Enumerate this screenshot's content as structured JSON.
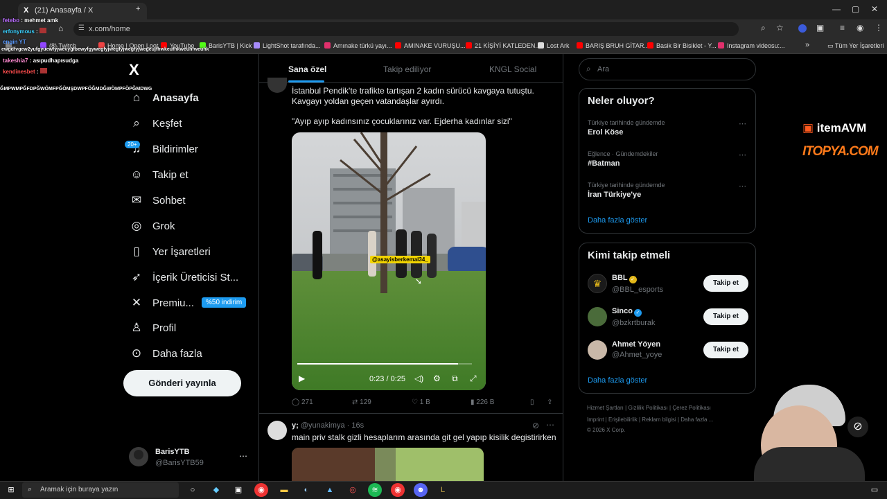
{
  "browser": {
    "tab_title": "(21) Anasayfa / X",
    "url": "x.com/home",
    "bookmarks": [
      {
        "label": "",
        "color": "#888"
      },
      {
        "label": "(8) Twitch",
        "color": "#9146ff"
      },
      {
        "label": "Home | Open Loot",
        "color": "#e44"
      },
      {
        "label": "YouTube",
        "color": "#f00"
      },
      {
        "label": "BarisYTB | Kick",
        "color": "#53fc18"
      },
      {
        "label": "LightShot tarafında...",
        "color": "#a78bfa"
      },
      {
        "label": "Amınake türkü yayı...",
        "color": "#e1306c"
      },
      {
        "label": "AMINAKE VURUŞU...",
        "color": "#f00"
      },
      {
        "label": "21 KİŞİYİ KATLEDEN...",
        "color": "#f00"
      },
      {
        "label": "Lost Ark",
        "color": "#ddd"
      },
      {
        "label": "BARIŞ BRUH GİTAR...",
        "color": "#f00"
      },
      {
        "label": "Basik Bir Bisiklet - Y...",
        "color": "#f00"
      },
      {
        "label": "Instagram videosu:...",
        "color": "#e1306c"
      }
    ],
    "all_bookmarks": "Tüm Yer İşaretleri"
  },
  "chat_overlay": [
    {
      "user": "fetebo",
      "msg": "mehmet amk",
      "color": "#b96bff"
    },
    {
      "user": "erfonymous",
      "msg": "",
      "color": "#3ad1ff"
    },
    {
      "user": "engin YT",
      "msg": "",
      "color": "#5b9bff"
    },
    {
      "user": "",
      "msg": "ewgdfvgew2yufgyuewfyjwevygfbewyfgywegfyjwegfyjwegfyjwegeujfhwkeufhkweuhfweuhk",
      "color": "#fff"
    },
    {
      "user": "takeshia7",
      "msg": "asıpudhapısudga",
      "color": "#ff8ad1"
    },
    {
      "user": "kendinesbet",
      "msg": "",
      "color": "#ff4d4d"
    },
    {
      "user": "",
      "msg": "ĞMPWMPĞFDPĞWÖMFPĞÖMŞDWPFÖĞMDĞWÖMPFÖPĞMDWG",
      "color": "#fff"
    }
  ],
  "nav": {
    "items": [
      {
        "label": "Anasayfa",
        "icon": "home-icon",
        "glyph": "⌂"
      },
      {
        "label": "Keşfet",
        "icon": "search-icon",
        "glyph": "⌕"
      },
      {
        "label": "Bildirimler",
        "icon": "bell-icon",
        "glyph": "♪"
      },
      {
        "label": "Takip et",
        "icon": "follow-icon",
        "glyph": "☺"
      },
      {
        "label": "Sohbet",
        "icon": "mail-icon",
        "glyph": "✉"
      },
      {
        "label": "Grok",
        "icon": "grok-icon",
        "glyph": "◎"
      },
      {
        "label": "Yer İşaretleri",
        "icon": "bookmark-icon",
        "glyph": "▮"
      },
      {
        "label": "İçerik Üreticisi St...",
        "icon": "rocket-icon",
        "glyph": "➶"
      },
      {
        "label": "Premiu...",
        "icon": "x-icon",
        "glyph": "✕"
      },
      {
        "label": "Profil",
        "icon": "profile-icon",
        "glyph": "♙"
      },
      {
        "label": "Daha fazla",
        "icon": "more-icon",
        "glyph": "⋯"
      }
    ],
    "notifications_badge": "20+",
    "premium_badge": "%50 indirim",
    "post_button": "Gönderi yayınla"
  },
  "account": {
    "name": "BarisYTB",
    "handle": "@BarisYTB59"
  },
  "feed": {
    "tabs": [
      "Sana özel",
      "Takip ediliyor",
      "KNGL Social"
    ],
    "tweet1": {
      "text1": "İstanbul Pendik'te trafikte tartışan 2 kadın sürücü kavgaya tutuştu. Kavgayı yoldan geçen vatandaşlar ayırdı.",
      "text2": "\"Ayıp ayıp kadınsınız çocuklarınız var. Ejderha kadınlar sizi\"",
      "watermark": "@asayisberkemal34_",
      "video_time": "0:23 / 0:25",
      "video_progress": 0.92,
      "replies": "271",
      "reposts": "129",
      "likes": "1 B",
      "views": "226 B"
    },
    "tweet2": {
      "name": "y;",
      "handle": "@yunakimya",
      "time": "16s",
      "text": "main priv stalk gizli hesaplarım arasında git gel yapıp kisilik degistirirken"
    }
  },
  "right": {
    "search_placeholder": "Ara",
    "trends_title": "Neler oluyor?",
    "trends": [
      {
        "meta": "Türkiye tarihinde gündemde",
        "title": "Erol Köse"
      },
      {
        "meta": "Eğlence · Gündemdekiler",
        "title": "#Batman"
      },
      {
        "meta": "Türkiye tarihinde gündemde",
        "title": "İran Türkiye'ye"
      }
    ],
    "show_more": "Daha fazla göster",
    "follow_title": "Kimi takip etmeli",
    "follow": [
      {
        "name": "BBL",
        "handle": "@BBL_esports",
        "verified_color": "#e2b719"
      },
      {
        "name": "Sinco",
        "handle": "@bzkrtburak",
        "verified_color": "#1d9bf0"
      },
      {
        "name": "Ahmet Yöyen",
        "handle": "@Ahmet_yoye",
        "verified_color": ""
      }
    ],
    "follow_button": "Takip et",
    "footer": [
      "Hizmet Şartları",
      "Gizlilik Politikası",
      "Çerez Politikası",
      "Imprint",
      "Erişilebilirlik",
      "Reklam bilgisi",
      "Daha fazla ...",
      "© 2026 X Corp."
    ]
  },
  "sponsor": {
    "top": "itemAVM",
    "bottom": "ITOPYA.COM"
  },
  "taskbar": {
    "search_placeholder": "Aramak için buraya yazın"
  }
}
